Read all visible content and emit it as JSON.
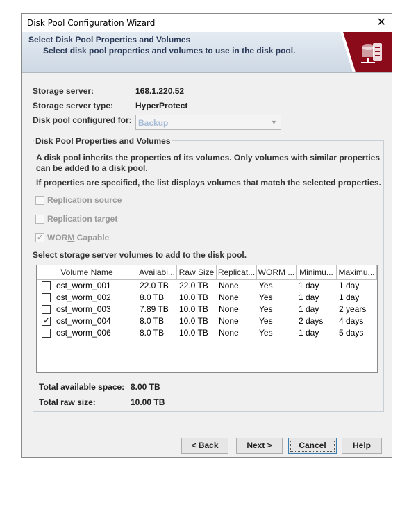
{
  "window": {
    "title": "Disk Pool Configuration Wizard",
    "close_glyph": "✕"
  },
  "banner": {
    "heading": "Select Disk Pool Properties and Volumes",
    "subheading": "Select disk pool properties and volumes to use in the disk pool.",
    "icon": "server-storage-icon",
    "accent_color": "#8b0b1a"
  },
  "server": {
    "storage_server_label": "Storage server:",
    "storage_server_value": "168.1.220.52",
    "type_label": "Storage server type:",
    "type_value": "HyperProtect",
    "configured_for_label": "Disk pool configured for:",
    "configured_for_value": "Backup"
  },
  "props": {
    "legend": "Disk Pool Properties and Volumes",
    "info_line1": "A disk pool inherits the properties of its volumes. Only volumes with similar properties",
    "info_line2": "can be added to a disk pool.",
    "info_line3": "If properties are specified, the list displays volumes that match the selected properties.",
    "replication_source": "Replication source",
    "replication_target": "Replication target",
    "worm_prefix": "WOR",
    "worm_mnemonic": "M",
    "worm_suffix": " Capable",
    "worm_checked": true,
    "select_prompt": "Select storage server volumes to add to the disk pool."
  },
  "table": {
    "columns": [
      "Volume Name",
      "Availabl...",
      "Raw Size",
      "Replicat...",
      "WORM ...",
      "Minimu...",
      "Maximu..."
    ],
    "rows": [
      {
        "checked": false,
        "cells": [
          "ost_worm_001",
          "22.0 TB",
          "22.0 TB",
          "None",
          "Yes",
          "1 day",
          "1 day"
        ]
      },
      {
        "checked": false,
        "cells": [
          "ost_worm_002",
          "8.0 TB",
          "10.0 TB",
          "None",
          "Yes",
          "1 day",
          "1 day"
        ]
      },
      {
        "checked": false,
        "cells": [
          "ost_worm_003",
          "7.89 TB",
          "10.0 TB",
          "None",
          "Yes",
          "1 day",
          "2 years"
        ]
      },
      {
        "checked": true,
        "cells": [
          "ost_worm_004",
          "8.0 TB",
          "10.0 TB",
          "None",
          "Yes",
          "2 days",
          "4 days"
        ]
      },
      {
        "checked": false,
        "cells": [
          "ost_worm_006",
          "8.0 TB",
          "10.0 TB",
          "None",
          "Yes",
          "1 day",
          "5 days"
        ]
      }
    ]
  },
  "totals": {
    "available_label": "Total available space:",
    "available_value": "8.00 TB",
    "raw_label": "Total raw size:",
    "raw_value": "10.00 TB"
  },
  "buttons": {
    "back_prefix": "< ",
    "back_mnemonic": "B",
    "back_suffix": "ack",
    "next_mnemonic": "N",
    "next_suffix": "ext >",
    "cancel_mnemonic": "C",
    "cancel_suffix": "ancel",
    "help_mnemonic": "H",
    "help_suffix": "elp"
  }
}
